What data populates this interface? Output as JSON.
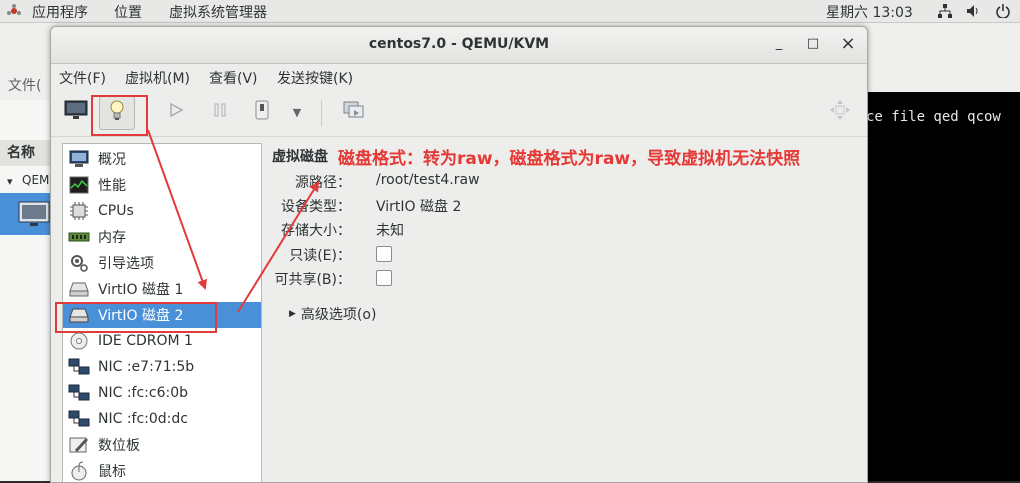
{
  "topbar": {
    "apps": "应用程序",
    "places": "位置",
    "app_name": "虚拟系统管理器",
    "clock": "星期六 13:03"
  },
  "background_window": {
    "menu_file": "文件(",
    "col_name": "名称",
    "vm_name": "QEMU",
    "terminal_text": "ce file qed qcow"
  },
  "window": {
    "title": "centos7.0 - QEMU/KVM",
    "minimize": "_",
    "maximize": "□",
    "close": "×"
  },
  "menubar": {
    "file": "文件(F)",
    "vm": "虚拟机(M)",
    "view": "查看(V)",
    "sendkey": "发送按键(K)"
  },
  "toolbar": {
    "icons": [
      "monitor-icon",
      "lightbulb-icon",
      "play-icon",
      "pause-icon",
      "power-icon",
      "dropdown-arrow-icon",
      "snapshot-icon",
      "fullscreen-icon"
    ]
  },
  "sidebar": {
    "items": [
      {
        "label": "概况",
        "icon": "overview-icon"
      },
      {
        "label": "性能",
        "icon": "performance-icon"
      },
      {
        "label": "CPUs",
        "icon": "cpu-icon"
      },
      {
        "label": "内存",
        "icon": "memory-icon"
      },
      {
        "label": "引导选项",
        "icon": "boot-options-icon"
      },
      {
        "label": "VirtIO 磁盘 1",
        "icon": "disk-icon"
      },
      {
        "label": "VirtIO 磁盘 2",
        "icon": "disk-icon"
      },
      {
        "label": "IDE CDROM 1",
        "icon": "cdrom-icon"
      },
      {
        "label": "NIC :e7:71:5b",
        "icon": "nic-icon"
      },
      {
        "label": "NIC :fc:c6:0b",
        "icon": "nic-icon"
      },
      {
        "label": "NIC :fc:0d:dc",
        "icon": "nic-icon"
      },
      {
        "label": "数位板",
        "icon": "tablet-icon"
      },
      {
        "label": "鼠标",
        "icon": "mouse-icon"
      }
    ],
    "selected_index": 6
  },
  "details": {
    "heading": "虚拟磁盘",
    "source_path_label": "源路径：",
    "source_path_value": "/root/test4.raw",
    "device_type_label": "设备类型：",
    "device_type_value": "VirtIO 磁盘 2",
    "storage_size_label": "存储大小：",
    "storage_size_value": "未知",
    "readonly_label": "只读(E)：",
    "readonly_checked": false,
    "shareable_label": "可共享(B)：",
    "shareable_checked": false,
    "advanced_label": "高级选项(o)"
  },
  "annotation": {
    "text": "磁盘格式：转为raw，磁盘格式为raw，导致虚拟机无法快照",
    "color": "#e53935"
  },
  "colors": {
    "selection": "#4a90d9",
    "annotation_red": "#e23b3b"
  }
}
